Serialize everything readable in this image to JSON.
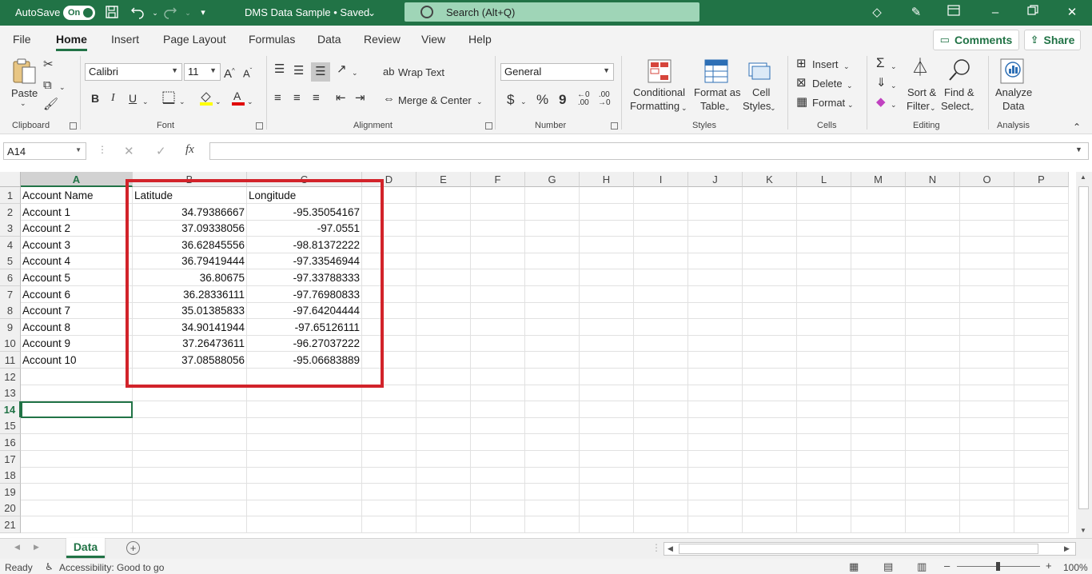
{
  "titlebar": {
    "autosave_label": "AutoSave",
    "autosave_state": "On",
    "doc_title": "DMS Data Sample • Saved",
    "search_placeholder": "Search (Alt+Q)",
    "accent_color": "#217346"
  },
  "menu": {
    "tabs": [
      "File",
      "Home",
      "Insert",
      "Page Layout",
      "Formulas",
      "Data",
      "Review",
      "View",
      "Help"
    ],
    "active": "Home",
    "comments_label": "Comments",
    "share_label": "Share"
  },
  "ribbon": {
    "clipboard": {
      "paste": "Paste",
      "label": "Clipboard"
    },
    "font": {
      "name": "Calibri",
      "size": "11",
      "bold": "B",
      "italic": "I",
      "underline": "U",
      "label": "Font"
    },
    "alignment": {
      "wrap": "Wrap Text",
      "merge": "Merge & Center",
      "label": "Alignment"
    },
    "number": {
      "format": "General",
      "currency": "$",
      "percent": "%",
      "comma": "9",
      "label": "Number"
    },
    "styles": {
      "cond1": "Conditional",
      "cond2": "Formatting",
      "fmt1": "Format as",
      "fmt2": "Table",
      "cell1": "Cell",
      "cell2": "Styles",
      "label": "Styles"
    },
    "cells": {
      "insert": "Insert",
      "delete": "Delete",
      "format": "Format",
      "label": "Cells"
    },
    "editing": {
      "sort1": "Sort &",
      "sort2": "Filter",
      "find1": "Find &",
      "find2": "Select",
      "label": "Editing"
    },
    "analysis": {
      "an1": "Analyze",
      "an2": "Data",
      "label": "Analysis"
    }
  },
  "formula_bar": {
    "name_box": "A14",
    "fx": "fx",
    "value": ""
  },
  "sheet": {
    "columns": [
      "A",
      "B",
      "C",
      "D",
      "E",
      "F",
      "G",
      "H",
      "I",
      "J",
      "K",
      "L",
      "M",
      "N",
      "O",
      "P"
    ],
    "row_numbers": [
      "1",
      "2",
      "3",
      "4",
      "5",
      "6",
      "7",
      "8",
      "9",
      "10",
      "11",
      "12",
      "13",
      "14",
      "15",
      "16",
      "17",
      "18",
      "19",
      "20",
      "21"
    ],
    "header": [
      "Account Name",
      "Latitude",
      "Longitude"
    ],
    "rows": [
      [
        "Account 1",
        "34.79386667",
        "-95.35054167"
      ],
      [
        "Account 2",
        "37.09338056",
        "-97.0551"
      ],
      [
        "Account 3",
        "36.62845556",
        "-98.81372222"
      ],
      [
        "Account 4",
        "36.79419444",
        "-97.33546944"
      ],
      [
        "Account 5",
        "36.80675",
        "-97.33788333"
      ],
      [
        "Account 6",
        "36.28336111",
        "-97.76980833"
      ],
      [
        "Account 7",
        "35.01385833",
        "-97.64204444"
      ],
      [
        "Account 8",
        "34.90141944",
        "-97.65126111"
      ],
      [
        "Account 9",
        "37.26473611",
        "-96.27037222"
      ],
      [
        "Account 10",
        "37.08588056",
        "-95.06683889"
      ]
    ],
    "selected_cell": "A14",
    "highlight_color": "#d2232a"
  },
  "sheet_tabs": {
    "active": "Data"
  },
  "statusbar": {
    "ready": "Ready",
    "accessibility": "Accessibility: Good to go",
    "zoom": "100%"
  }
}
